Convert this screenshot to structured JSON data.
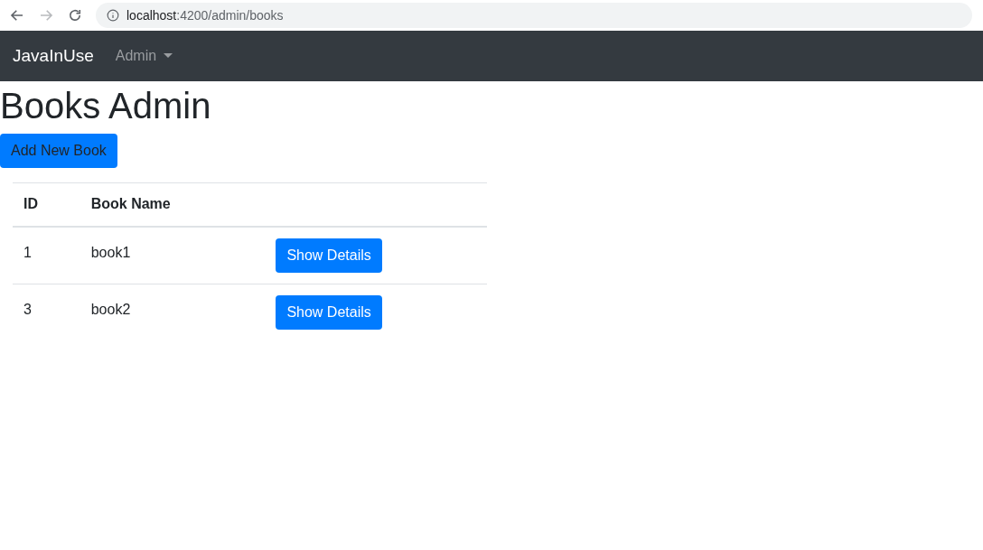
{
  "browser": {
    "url_host": "localhost",
    "url_path": ":4200/admin/books",
    "forward_disabled": true
  },
  "navbar": {
    "brand": "JavaInUse",
    "menu": "Admin"
  },
  "title": "Books Admin",
  "add_button": "Add New Book",
  "table": {
    "columns": [
      "ID",
      "Book Name"
    ],
    "rows": [
      {
        "id": "1",
        "name": "book1",
        "action": "Show Details"
      },
      {
        "id": "3",
        "name": "book2",
        "action": "Show Details"
      }
    ]
  }
}
